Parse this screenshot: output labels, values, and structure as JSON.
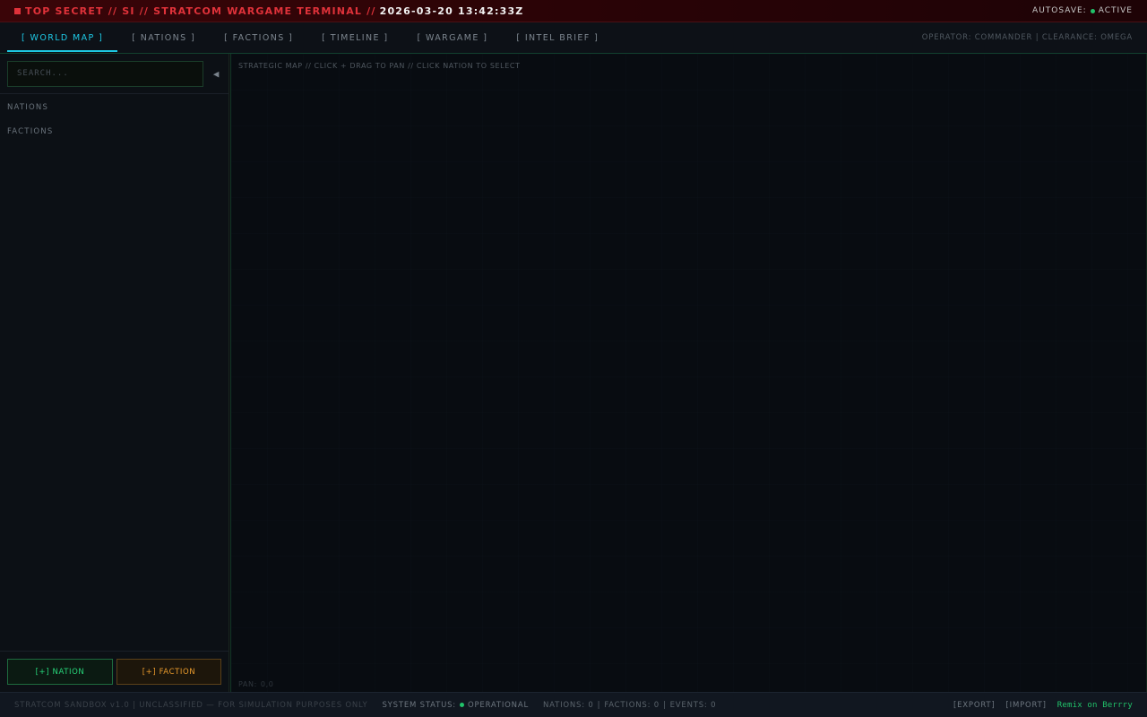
{
  "classification": {
    "marker_icon": "square-icon",
    "text": "TOP SECRET // SI // STRATCOM WARGAME TERMINAL //",
    "clock": "2026-03-20 13:42:33Z",
    "autosave_label": "AUTOSAVE:",
    "autosave_status": "ACTIVE",
    "colors": {
      "banner": "#e0323a",
      "status_ok": "#21c26a"
    }
  },
  "nav": {
    "tabs": [
      {
        "label": "[ WORLD MAP ]",
        "active": true
      },
      {
        "label": "[ NATIONS ]",
        "active": false
      },
      {
        "label": "[ FACTIONS ]",
        "active": false
      },
      {
        "label": "[ TIMELINE ]",
        "active": false
      },
      {
        "label": "[ WARGAME ]",
        "active": false
      },
      {
        "label": "[ INTEL BRIEF ]",
        "active": false
      }
    ],
    "operator": "OPERATOR: COMMANDER | CLEARANCE: OMEGA",
    "accent": "#1ec8e4"
  },
  "sidebar": {
    "search_placeholder": "SEARCH...",
    "collapse_icon": "collapse-left-icon",
    "sections": [
      "NATIONS",
      "FACTIONS"
    ],
    "add_nation_label": "[+] NATION",
    "add_faction_label": "[+] FACTION"
  },
  "map": {
    "hint": "STRATEGIC MAP // CLICK + DRAG TO PAN // CLICK NATION TO SELECT",
    "pan_label": "PAN:",
    "pan_value": "0,0"
  },
  "status": {
    "build": "STRATCOM SANDBOX v1.0 | UNCLASSIFIED — FOR SIMULATION PURPOSES ONLY",
    "system_label": "SYSTEM STATUS:",
    "system_value": "OPERATIONAL",
    "nations": "NATIONS: 0",
    "factions": "FACTIONS: 0",
    "events": "EVENTS: 0",
    "separator": "|",
    "export_label": "[EXPORT]",
    "import_label": "[IMPORT]",
    "remix_label": "Remix on Berrry"
  }
}
